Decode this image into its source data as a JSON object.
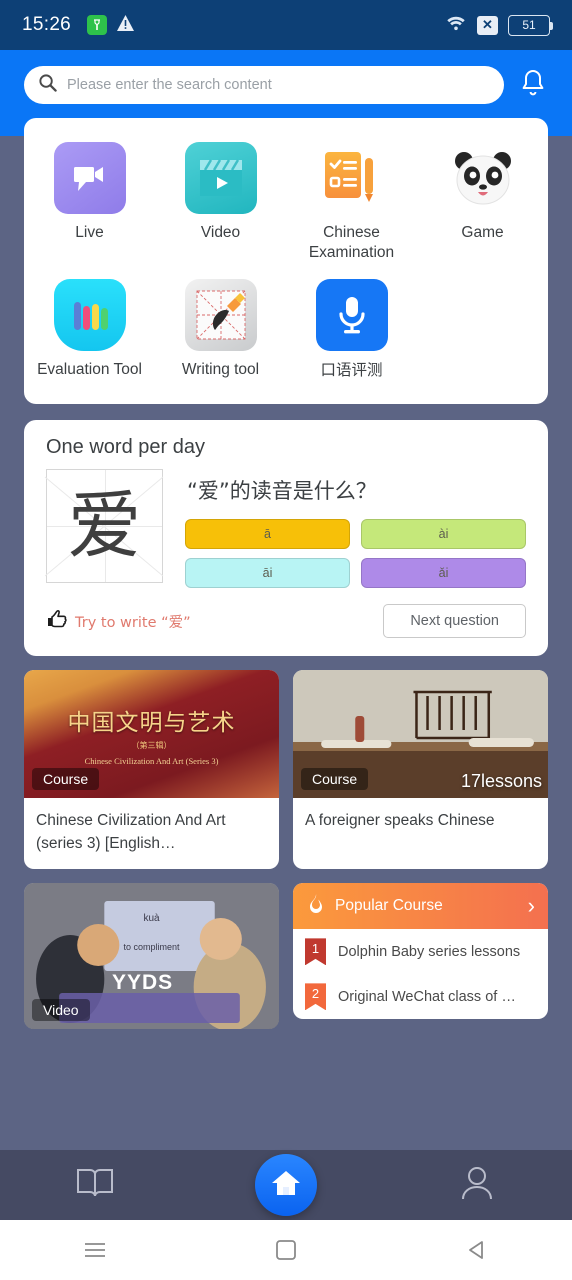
{
  "status_bar": {
    "time": "15:26",
    "battery_level": "51",
    "icons": [
      "app-green-icon",
      "warning-triangle-icon",
      "wifi-icon",
      "signal-off-icon",
      "battery-icon"
    ]
  },
  "header": {
    "search_placeholder": "Please enter the search content",
    "search_value": "",
    "notification_icon": "bell-icon",
    "background_color": "#0a76f6"
  },
  "shortcuts": [
    {
      "label": "Live",
      "icon": "live-video-icon",
      "color": "#9b8cf0"
    },
    {
      "label": "Video",
      "icon": "clapperboard-icon",
      "color": "#34c3ca"
    },
    {
      "label": "Chinese Examination",
      "icon": "checklist-pen-icon",
      "color": "#f9a63a"
    },
    {
      "label": "Game",
      "icon": "panda-icon",
      "color": "#efefef"
    },
    {
      "label": "Evaluation Tool",
      "icon": "bar-levels-icon",
      "color": "#25d8f5"
    },
    {
      "label": "Writing tool",
      "icon": "brush-grid-icon",
      "color": "#d6d6d6"
    },
    {
      "label": "口语评测",
      "icon": "microphone-icon",
      "color": "#1677f5"
    }
  ],
  "word_of_day": {
    "title": "One word per day",
    "character": "爱",
    "question": "“爱”的读音是什么？",
    "answers": [
      {
        "text": "ā",
        "color": "#f7c008"
      },
      {
        "text": "ài",
        "color": "#c5e87a"
      },
      {
        "text": "āi",
        "color": "#b8f4f4"
      },
      {
        "text": "ǎi",
        "color": "#ae8ae8"
      }
    ],
    "try_write_label": "Try to write “爱”",
    "try_write_icon": "pointing-hand-icon",
    "next_button": "Next question",
    "try_write_color": "#e07a6e"
  },
  "courses": [
    {
      "badge": "Course",
      "lessons": "",
      "title": "Chinese Civilization And Art (series 3) [English…",
      "thumb_cn": "中国文明与艺术",
      "thumb_sub": "（第三辑）",
      "thumb_en": "Chinese Civilization And Art (Series 3)",
      "art": "art-civ"
    },
    {
      "badge": "Course",
      "lessons": "17lessons",
      "title": "A foreigner speaks Chinese",
      "thumb_cn": "",
      "thumb_sub": "",
      "thumb_en": "",
      "art": "art-desk"
    }
  ],
  "video_card": {
    "badge": "Video",
    "overlay_text": "YYDS",
    "pinyin": "kuà",
    "translation": "to compliment",
    "art": "art-video"
  },
  "popular": {
    "title": "Popular Course",
    "flame_icon": "flame-icon",
    "arrow_icon": "chevron-right-icon",
    "items": [
      {
        "rank": "1",
        "text": "Dolphin Baby series lessons",
        "color": "#c0392f"
      },
      {
        "rank": "2",
        "text": "Original WeChat class of …",
        "color": "#f2683c"
      }
    ]
  },
  "tabbar": {
    "items": [
      {
        "name": "book",
        "icon": "open-book-icon",
        "active": false
      },
      {
        "name": "home",
        "icon": "home-icon",
        "active": true
      },
      {
        "name": "profile",
        "icon": "person-icon",
        "active": false
      }
    ],
    "background_color": "#454a63",
    "home_color": "#0a63f0"
  },
  "android_nav": {
    "buttons": [
      "menu-icon",
      "home-square-icon",
      "back-triangle-icon"
    ]
  }
}
